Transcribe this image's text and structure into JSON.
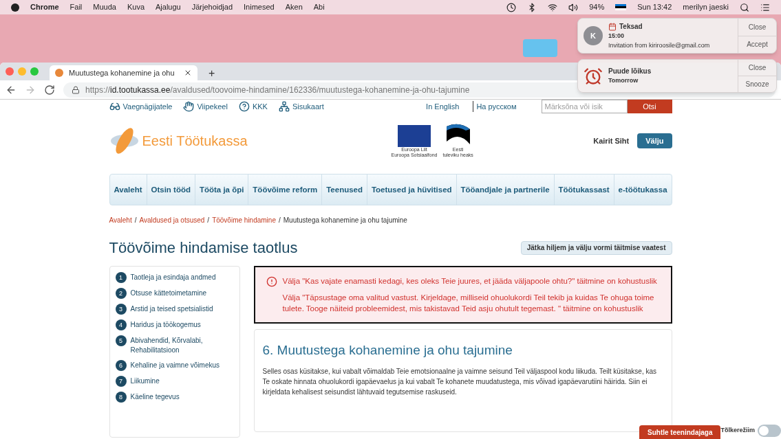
{
  "menubar": {
    "app": "Chrome",
    "menus": [
      "Fail",
      "Muuda",
      "Kuva",
      "Ajalugu",
      "Järjehoidjad",
      "Inimesed",
      "Aken",
      "Abi"
    ],
    "battery": "94%",
    "clock": "Sun 13:42",
    "user": "merilyn jaeski"
  },
  "browser": {
    "tab_title": "Muutustega kohanemine ja ohu",
    "new_tab": "+",
    "url_scheme": "https://",
    "url_host": "id.tootukassa.ee",
    "url_path": "/avaldused/toovoime-hindamine/162336/muutustega-kohanemine-ja-ohu-tajumine"
  },
  "notifications": [
    {
      "kind": "invite",
      "avatar": "K",
      "title": "Teksad",
      "time": "15:00",
      "body": "Invitation from kiriroosile@gmail.com",
      "actions": [
        "Close",
        "Accept"
      ]
    },
    {
      "kind": "reminder",
      "title": "Puude lõikus",
      "body": "Tomorrow",
      "actions": [
        "Close",
        "Snooze"
      ]
    }
  ],
  "page": {
    "utility_links": [
      {
        "kind": "glasses",
        "label": "Vaegnägijatele"
      },
      {
        "kind": "hand",
        "label": "Viipekeel"
      },
      {
        "kind": "question",
        "label": "KKK"
      },
      {
        "kind": "sitemap",
        "label": "Sisukaart"
      }
    ],
    "lang_links": [
      "In English",
      "На русском"
    ],
    "search": {
      "placeholder": "Märksõna või isik",
      "button": "Otsi"
    },
    "logo_text": "Eesti Töötukassa",
    "eu_caption": [
      "Euroopa Liit",
      "Euroopa Sotsiaalfond"
    ],
    "ee_caption": [
      "Eesti",
      "tuleviku heaks"
    ],
    "user": "Kairit Siht",
    "logout": "Välju",
    "nav": [
      "Avaleht",
      "Otsin tööd",
      "Tööta ja õpi",
      "Töövõime reform",
      "Teenused",
      "Toetused ja hüvitised",
      "Tööandjale ja partnerile",
      "Töötukassast",
      "e-töötukassa"
    ],
    "breadcrumb_separator": "/",
    "breadcrumb": [
      {
        "label": "Avaleht",
        "link": true
      },
      {
        "label": "Avaldused ja otsused",
        "link": true
      },
      {
        "label": "Töövõime hindamine",
        "link": true
      },
      {
        "label": "Muutustega kohanemine ja ohu tajumine",
        "link": false
      }
    ],
    "title": "Töövõime hindamise taotlus",
    "later_button": "Jätka hiljem ja välju vormi täitmise vaatest",
    "steps": [
      {
        "number": "1",
        "label": "Taotleja ja esindaja andmed"
      },
      {
        "number": "2",
        "label": "Otsuse kättetoimetamine"
      },
      {
        "number": "3",
        "label": "Arstid ja teised spetsialistid"
      },
      {
        "number": "4",
        "label": "Haridus ja töökogemus"
      },
      {
        "number": "5",
        "label": "Abivahendid, Kõrvalabi, Rehabilitatsioon"
      },
      {
        "number": "6",
        "label": "Kehaline ja vaimne võimekus"
      },
      {
        "number": "7",
        "label": "Liikumine"
      },
      {
        "number": "8",
        "label": "Käeline tegevus"
      }
    ],
    "errors": [
      "Välja \"Kas vajate enamasti kedagi, kes oleks Teie juures, et jääda väljapoole ohtu?\" täitmine on kohustuslik",
      "Välja \"Täpsustage oma valitud vastust. Kirjeldage, milliseid ohuolukordi Teil tekib ja kuidas Te ohuga toime tulete. Tooge näiteid probleemidest, mis takistavad Teid asju ohutult tegemast. \" täitmine on kohustuslik"
    ],
    "section": {
      "heading": "6. Muutustega kohanemine ja ohu tajumine",
      "text": "Selles osas küsitakse, kui vabalt võimaldab Teie emotsionaalne ja vaimne seisund Teil väljaspool kodu liikuda. Teilt küsitakse, kas Te oskate hinnata ohuolukordi igapäevaelus ja kui vabalt Te kohanete muudatustega, mis võivad igapäevarutiini häirida. Siin ei kirjeldata kehalisest seisundist lähtuvaid tegutsemise raskuseid."
    },
    "chat_button": "Suhtle teenindajaga",
    "translate": {
      "label": "Tõlkerežiim",
      "on": false
    }
  }
}
